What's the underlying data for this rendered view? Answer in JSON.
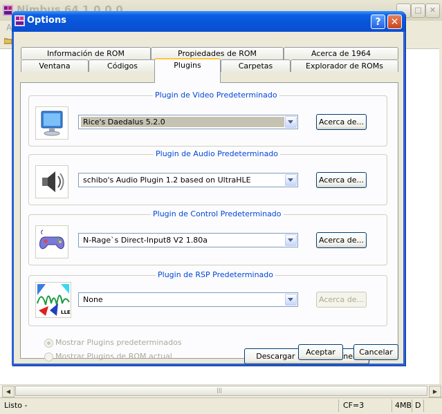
{
  "background_app": {
    "title": "Nimbus 64 1.0.0.0",
    "side_letter": "A",
    "status": {
      "message": "Listo -",
      "cf": "CF=3",
      "memory": "4MB",
      "extra": "D"
    }
  },
  "dialog": {
    "title": "Options",
    "help_glyph": "?",
    "close_glyph": "✕",
    "tabs_row1": [
      "Información de ROM",
      "Propiedades de ROM",
      "Acerca de 1964"
    ],
    "tabs_row2": [
      "Ventana",
      "Códigos",
      "Plugins",
      "Carpetas",
      "Explorador de ROMs"
    ],
    "active_tab": "Plugins",
    "groups": [
      {
        "label": "Plugin de Video Predeterminado",
        "icon": "monitor-icon",
        "value": "Rice's Daedalus 5.2.0",
        "about": "Acerca de..."
      },
      {
        "label": "Plugin de Audio Predeterminado",
        "icon": "speaker-icon",
        "value": "schibo's Audio Plugin 1.2 based on UltraHLE",
        "about": "Acerca de..."
      },
      {
        "label": "Plugin de Control Predeterminado",
        "icon": "gamepad-icon",
        "value": "N-Rage`s Direct-Input8 V2 1.80a",
        "about": "Acerca de..."
      },
      {
        "label": "Plugin de RSP Predeterminado",
        "icon": "rsp-lle-icon",
        "icon_text": "LLE",
        "value": "None",
        "about": "Acerca de..."
      }
    ],
    "radio_default": "Mostrar Plugins predeterminados",
    "radio_rom": "Mostrar Plugins de ROM actual",
    "download_button": "Descargar Plugins en línea",
    "ok": "Aceptar",
    "cancel": "Cancelar"
  },
  "colors": {
    "title_blue": "#0a5fe3",
    "group_label": "#0046d5",
    "tab_highlight": "#ffc83c",
    "close_red": "#c9451d"
  }
}
